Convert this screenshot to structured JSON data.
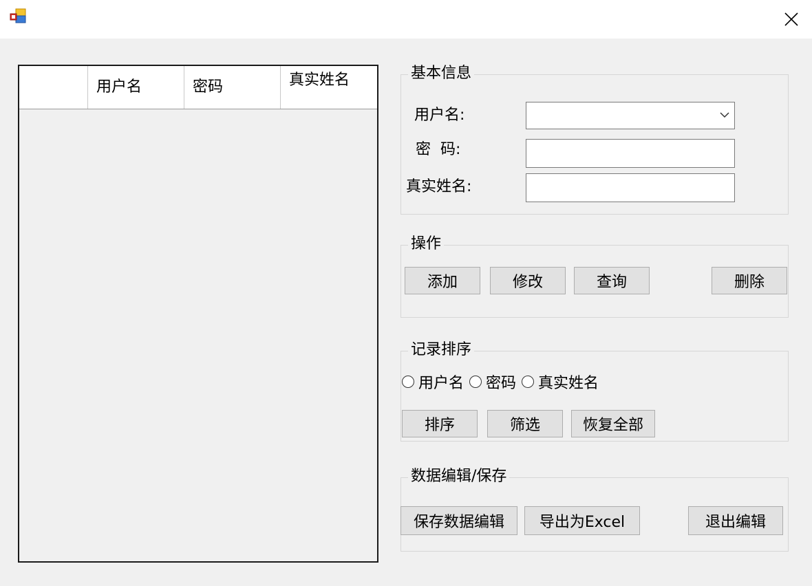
{
  "window": {
    "app_icon": "winforms-app-icon",
    "close_glyph": "✕"
  },
  "grid": {
    "columns": [
      "",
      "用户名",
      "密码",
      "真实姓名"
    ]
  },
  "basic_info": {
    "title": "基本信息",
    "username_label": "用户名:",
    "password_label": "密  码:",
    "realname_label": "真实姓名:",
    "username_value": "",
    "password_value": "",
    "realname_value": ""
  },
  "operations": {
    "title": "操作",
    "add": "添加",
    "modify": "修改",
    "query": "查询",
    "delete": "删除"
  },
  "sorting": {
    "title": "记录排序",
    "options": [
      "用户名",
      "密码",
      "真实姓名"
    ],
    "sort": "排序",
    "filter": "筛选",
    "restore_all": "恢复全部"
  },
  "data_edit": {
    "title": "数据编辑/保存",
    "save": "保存数据编辑",
    "export": "导出为Excel",
    "exit": "退出编辑"
  }
}
